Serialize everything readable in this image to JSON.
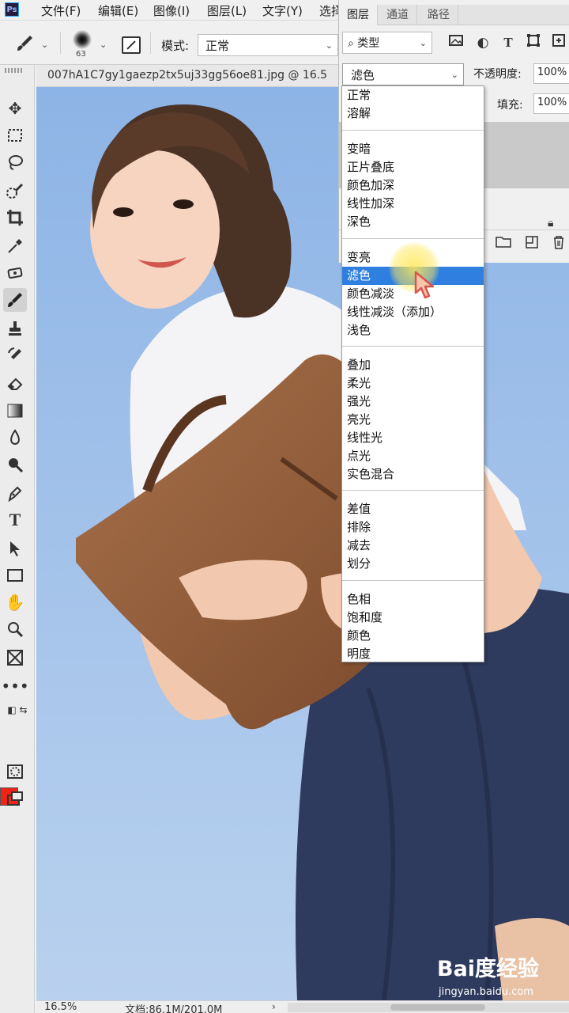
{
  "app": {
    "logo": "Ps"
  },
  "menu": [
    "文件(F)",
    "编辑(E)",
    "图像(I)",
    "图层(L)",
    "文字(Y)",
    "选择"
  ],
  "options_bar": {
    "brush_size": "63",
    "mode_label": "模式:",
    "mode_value": "正常"
  },
  "document": {
    "tab_title": "007hA1C7gy1gaezp2tx5uj33gg56oe81.jpg @ 16.5",
    "zoom": "16.5%",
    "doc_info": "文档:86.1M/201.0M"
  },
  "layers_panel": {
    "tabs": [
      "图层",
      "通道",
      "路径"
    ],
    "kind_filter": "类型",
    "blend_mode": "滤色",
    "opacity_label": "不透明度:",
    "opacity_value": "100%",
    "fill_label": "填充:",
    "fill_value": "100%"
  },
  "blend_menu": {
    "selected": "滤色",
    "groups": [
      [
        "正常",
        "溶解"
      ],
      [
        "变暗",
        "正片叠底",
        "颜色加深",
        "线性加深",
        "深色"
      ],
      [
        "变亮",
        "滤色",
        "颜色减淡",
        "线性减淡（添加）",
        "浅色"
      ],
      [
        "叠加",
        "柔光",
        "强光",
        "亮光",
        "线性光",
        "点光",
        "实色混合"
      ],
      [
        "差值",
        "排除",
        "减去",
        "划分"
      ],
      [
        "色相",
        "饱和度",
        "颜色",
        "明度"
      ]
    ]
  },
  "colors": {
    "foreground": "#ee2416",
    "background": "#ffffff",
    "selection": "#2f7fe0",
    "sky": "#9fbee5"
  },
  "watermark": {
    "logo": "Bai度经验",
    "url": "jingyan.baidu.com"
  }
}
